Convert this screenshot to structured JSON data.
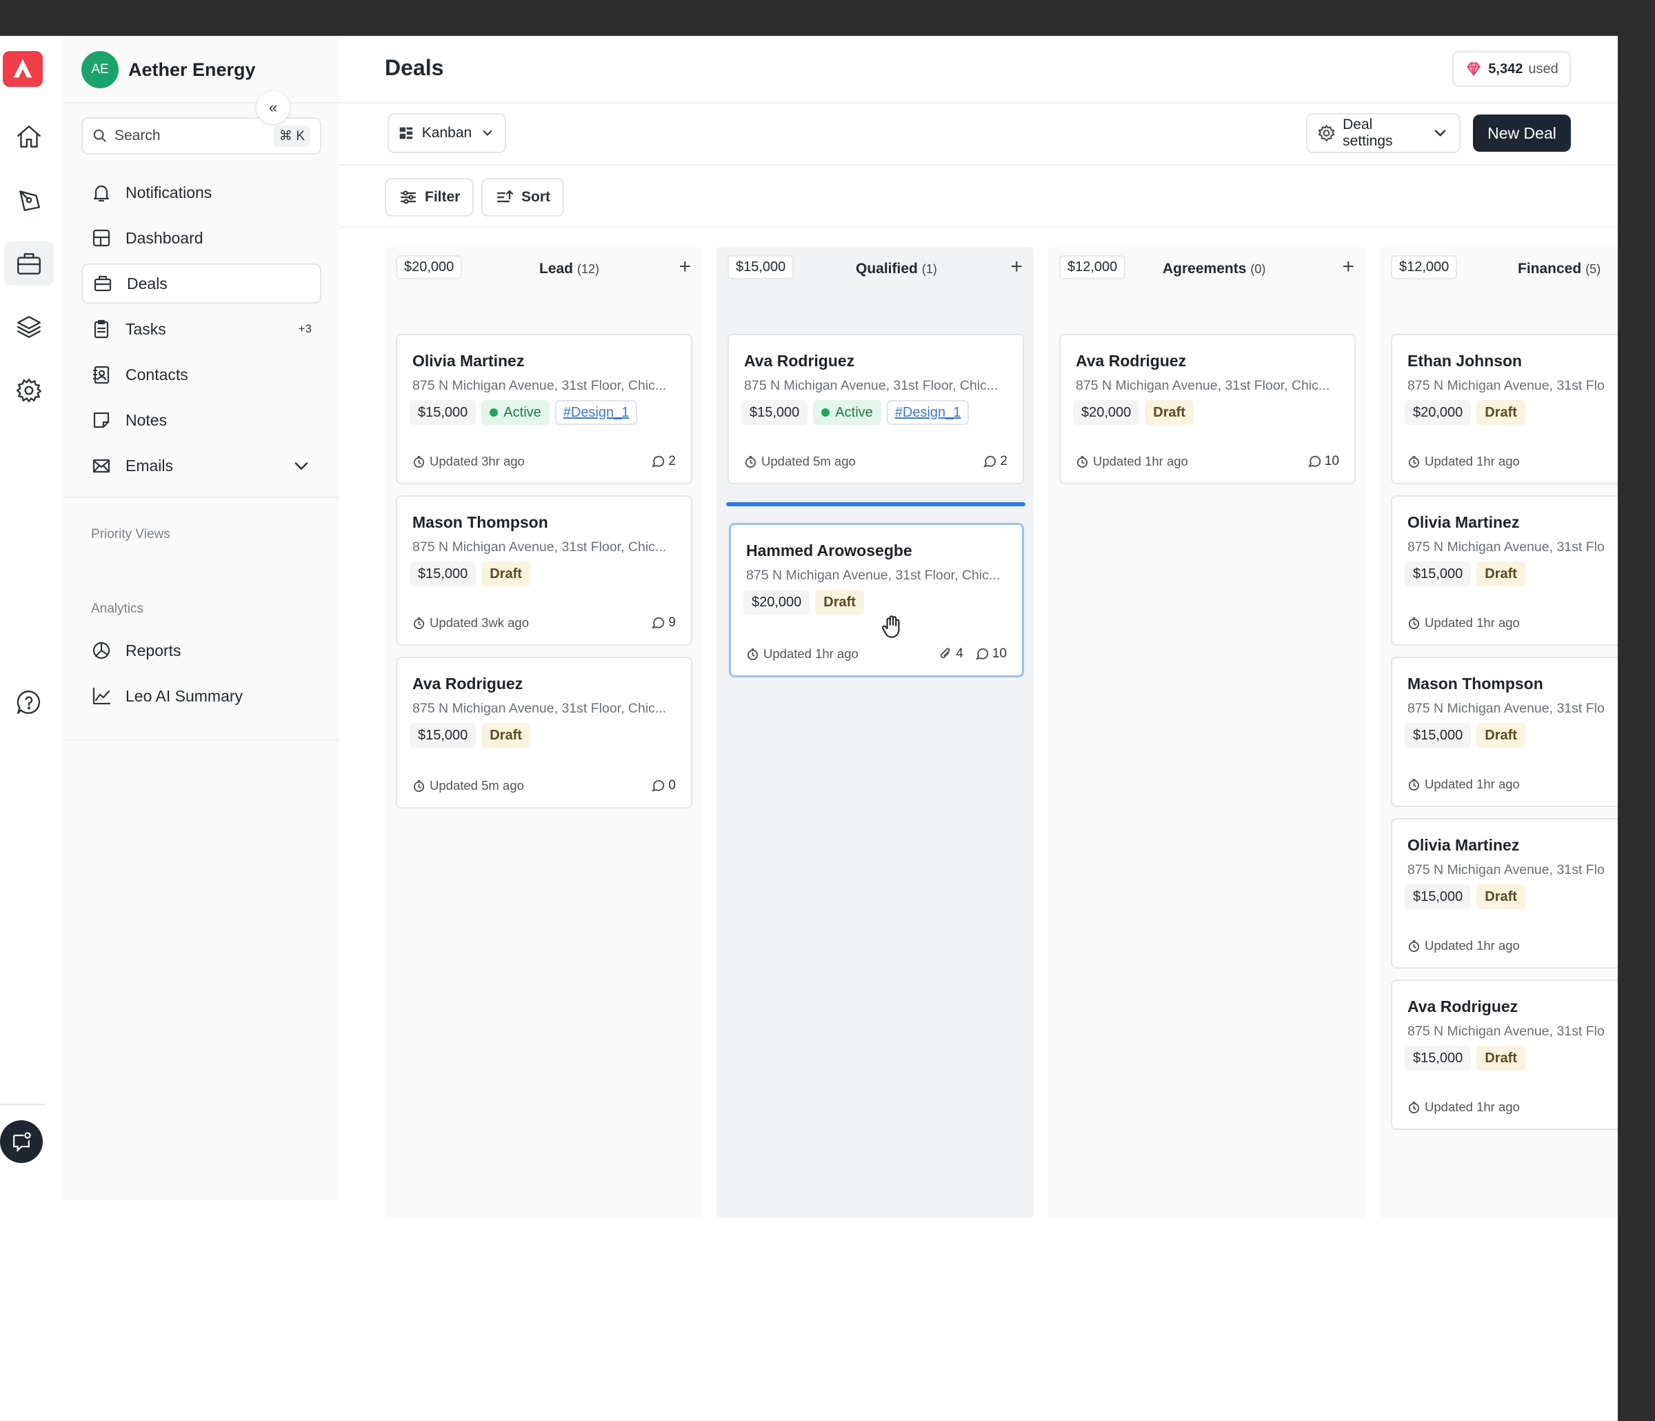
{
  "workspace": {
    "initials": "AE",
    "name": "Aether Energy"
  },
  "search": {
    "placeholder": "Search",
    "shortcut": "⌘ K"
  },
  "nav": {
    "notifications": "Notifications",
    "dashboard": "Dashboard",
    "deals": "Deals",
    "tasks": "Tasks",
    "tasks_badge": "+3",
    "contacts": "Contacts",
    "notes": "Notes",
    "emails": "Emails"
  },
  "sections": {
    "priority": "Priority Views",
    "analytics": "Analytics"
  },
  "analytics_items": {
    "reports": "Reports",
    "leo": "Leo AI Summary"
  },
  "header": {
    "title": "Deals",
    "usage_value": "5,342",
    "usage_label": "used"
  },
  "toolbar": {
    "view": "Kanban",
    "deal_settings": "Deal settings",
    "new_deal": "New Deal",
    "filter": "Filter",
    "sort": "Sort"
  },
  "colors": {
    "accent": "#1d2733",
    "drop_indicator": "#2f7be0",
    "brand": "#ef3e4a",
    "avatar": "#1aa36a"
  },
  "columns": [
    {
      "amount": "$20,000",
      "title": "Lead",
      "count": "(12)",
      "cards": [
        {
          "name": "Olivia Martinez",
          "address": "875 N Michigan Avenue, 31st Floor, Chic...",
          "amount": "$15,000",
          "status": "Active",
          "link": "#Design_1",
          "updated": "Updated 3hr ago",
          "comments": "2"
        },
        {
          "name": "Mason Thompson",
          "address": "875 N Michigan Avenue, 31st Floor, Chic...",
          "amount": "$15,000",
          "status": "Draft",
          "updated": "Updated 3wk ago",
          "comments": "9"
        },
        {
          "name": "Ava Rodriguez",
          "address": "875 N Michigan Avenue, 31st Floor, Chic...",
          "amount": "$15,000",
          "status": "Draft",
          "updated": "Updated 5m ago",
          "comments": "0"
        }
      ]
    },
    {
      "amount": "$15,000",
      "title": "Qualified",
      "count": "(1)",
      "cards": [
        {
          "name": "Ava Rodriguez",
          "address": "875 N Michigan Avenue, 31st Floor, Chic...",
          "amount": "$15,000",
          "status": "Active",
          "link": "#Design_1",
          "updated": "Updated 5m ago",
          "comments": "2"
        },
        {
          "name": "Hammed Arowosegbe",
          "address": "875 N Michigan Avenue, 31st Floor, Chic...",
          "amount": "$20,000",
          "status": "Draft",
          "updated": "Updated 1hr ago",
          "attachments": "4",
          "comments": "10"
        }
      ]
    },
    {
      "amount": "$12,000",
      "title": "Agreements",
      "count": "(0)",
      "cards": [
        {
          "name": "Ava Rodriguez",
          "address": "875 N Michigan Avenue, 31st Floor, Chic...",
          "amount": "$20,000",
          "status": "Draft",
          "updated": "Updated 1hr ago",
          "comments": "10"
        }
      ]
    },
    {
      "amount": "$12,000",
      "title": "Financed",
      "count": "(5)",
      "cards": [
        {
          "name": "Ethan Johnson",
          "address": "875 N Michigan Avenue, 31st Flo",
          "amount": "$20,000",
          "status": "Draft",
          "updated": "Updated 1hr ago"
        },
        {
          "name": "Olivia Martinez",
          "address": "875 N Michigan Avenue, 31st Flo",
          "amount": "$15,000",
          "status": "Draft",
          "updated": "Updated 1hr ago"
        },
        {
          "name": "Mason Thompson",
          "address": "875 N Michigan Avenue, 31st Flo",
          "amount": "$15,000",
          "status": "Draft",
          "updated": "Updated 1hr ago"
        },
        {
          "name": "Olivia Martinez",
          "address": "875 N Michigan Avenue, 31st Flo",
          "amount": "$15,000",
          "status": "Draft",
          "updated": "Updated 1hr ago"
        },
        {
          "name": "Ava Rodriguez",
          "address": "875 N Michigan Avenue, 31st Flo",
          "amount": "$15,000",
          "status": "Draft",
          "updated": "Updated 1hr ago"
        }
      ]
    }
  ]
}
